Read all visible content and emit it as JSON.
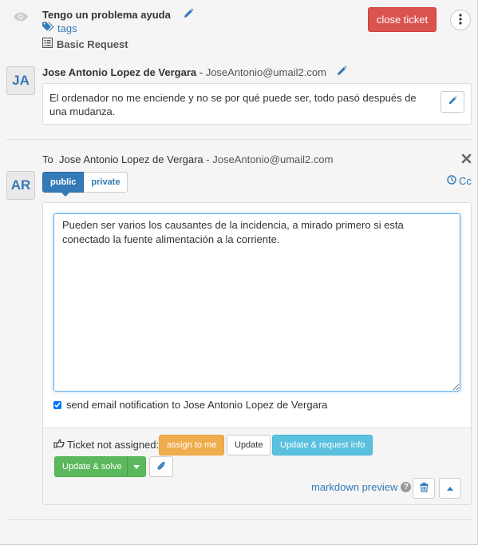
{
  "ticket": {
    "title": "Tengo un problema ayuda",
    "tags_label": "tags",
    "request_type": "Basic Request",
    "close_label": "close ticket"
  },
  "message": {
    "avatar_initials": "JA",
    "author_name": "Jose Antonio Lopez de Vergara",
    "separator": " - ",
    "author_email": "JoseAntonio@umail2.com",
    "body": "El ordenador no me enciende y no se por qué puede ser, todo pasó después de una mudanza."
  },
  "reply": {
    "avatar_initials": "AR",
    "to_label": "To",
    "recipient_name": "Jose Antonio Lopez de Vergara",
    "separator": " - ",
    "recipient_email": "JoseAntonio@umail2.com",
    "tabs": [
      {
        "label": "public",
        "active": true
      },
      {
        "label": "private",
        "active": false
      }
    ],
    "cc_label": "Cc",
    "text": "Pueden ser varios los causantes de la incidencia, a mirado primero si esta conectado la fuente alimentación a la corriente.",
    "notify_checked": true,
    "notify_label": "send email notification to Jose Antonio Lopez de Vergara"
  },
  "actions": {
    "assign_status": "Ticket not assigned:",
    "assign_to_me": "assign to me",
    "update": "Update",
    "update_request_info": "Update & request info",
    "update_solve": "Update & solve",
    "markdown_preview": "markdown preview"
  },
  "colors": {
    "primary": "#337ab7",
    "danger": "#d9534f",
    "warning": "#f0ad4e",
    "info": "#5bc0de",
    "success": "#5cb85c"
  }
}
